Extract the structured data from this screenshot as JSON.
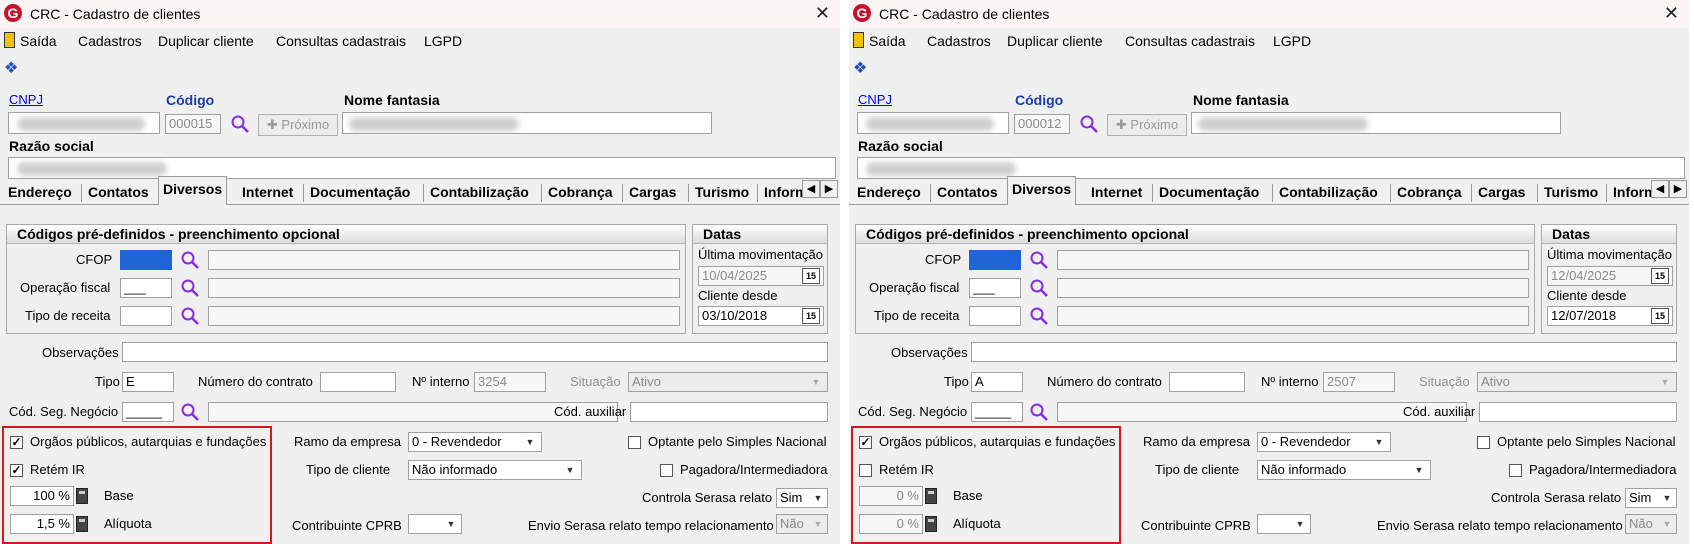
{
  "app": {
    "title": "CRC - Cadastro de clientes",
    "logo": "G",
    "close": "✕",
    "menu": [
      "Saída",
      "Cadastros",
      "Duplicar cliente",
      "Consultas cadastrais",
      "LGPD"
    ]
  },
  "labels": {
    "cnpj": "CNPJ",
    "codigo": "Código",
    "nome_fantasia": "Nome fantasia",
    "proximo": "Próximo",
    "razao_social": "Razão social",
    "codigos_panel": "Códigos pré-definidos - preenchimento opcional",
    "cfop": "CFOP",
    "operacao_fiscal": "Operação fiscal",
    "tipo_receita": "Tipo de receita",
    "datas": "Datas",
    "ultima_mov": "Última movimentação",
    "cliente_desde": "Cliente desde",
    "observacoes": "Observações",
    "tipo": "Tipo",
    "numero_contrato": "Número do contrato",
    "n_interno": "Nº interno",
    "situacao": "Situação",
    "cod_seg": "Cód. Seg. Negócio",
    "cod_aux": "Cód. auxiliar",
    "orgaos": "Orgãos públicos, autarquias e fundações",
    "retem_ir": "Retém IR",
    "base": "Base",
    "aliquota": "Alíquota",
    "ramo": "Ramo da empresa",
    "tipo_cliente": "Tipo de cliente",
    "optante": "Optante pelo Simples Nacional",
    "pagadora": "Pagadora/Intermediadora",
    "serasa": "Controla Serasa relato",
    "cprb": "Contribuinte CPRB",
    "envio_serasa": "Envio Serasa relato tempo relacionamento",
    "cal_icon": "15"
  },
  "tabs": [
    "Endereço",
    "Contatos",
    "Diversos",
    "Internet",
    "Documentação",
    "Contabilização",
    "Cobrança",
    "Cargas",
    "Turismo",
    "Inform"
  ],
  "windows": [
    {
      "codigo": "000015",
      "ultima_mov": "10/04/2025",
      "cliente_desde": "03/10/2018",
      "tipo": "E",
      "n_interno": "3254",
      "situacao": "Ativo",
      "operacao_fiscal": "___",
      "cod_seg": "_____",
      "orgaos_checked": true,
      "retem_ir_checked": true,
      "base": "100 %",
      "aliquota": "1,5 %",
      "ramo": "0 - Revendedor",
      "tipo_cliente": "Não informado",
      "serasa": "Sim",
      "envio_serasa": "Não"
    },
    {
      "codigo": "000012",
      "ultima_mov": "12/04/2025",
      "cliente_desde": "12/07/2018",
      "tipo": "A",
      "n_interno": "2507",
      "situacao": "Ativo",
      "operacao_fiscal": "___",
      "cod_seg": "_____",
      "orgaos_checked": true,
      "retem_ir_checked": false,
      "base": "0 %",
      "aliquota": "0 %",
      "ramo": "0 - Revendedor",
      "tipo_cliente": "Não informado",
      "serasa": "Sim",
      "envio_serasa": "Não"
    }
  ],
  "colors": {
    "highlight": "#d11a1a",
    "selection": "#1e64d6",
    "logo": "#c8102e"
  }
}
